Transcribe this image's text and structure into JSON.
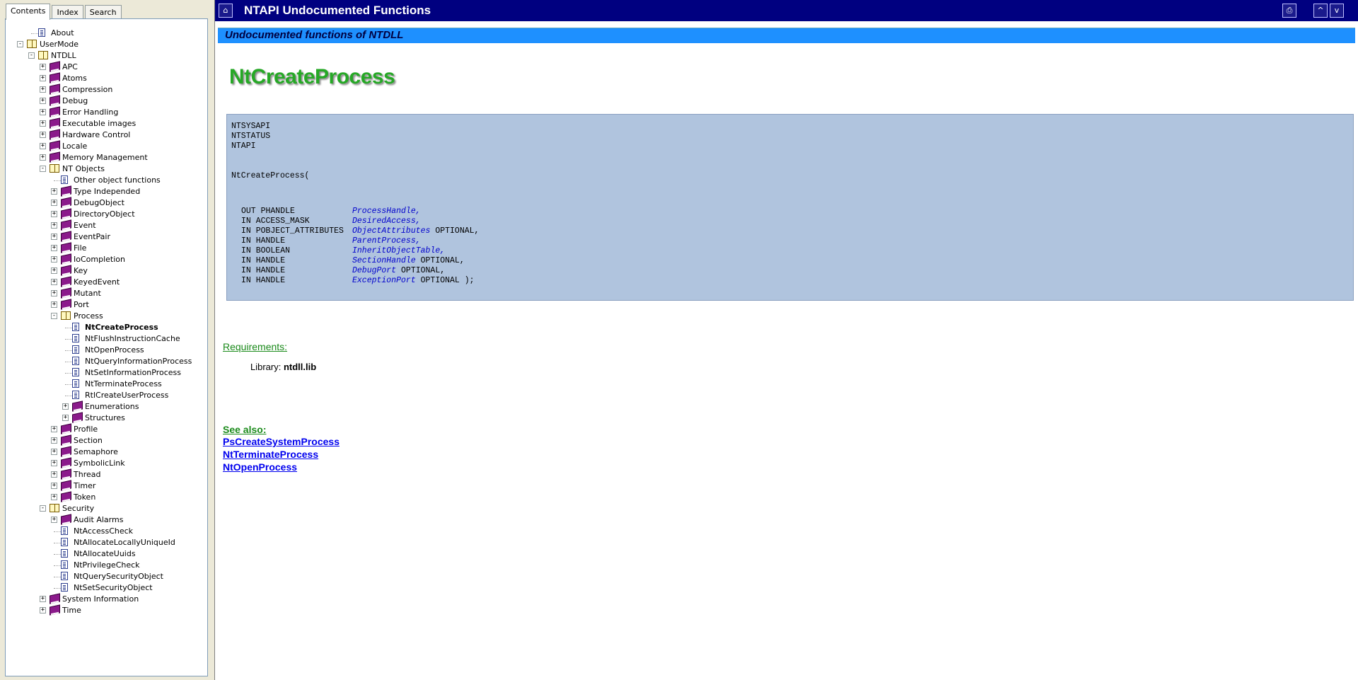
{
  "nav": {
    "tabs": [
      "Contents",
      "Index",
      "Search"
    ],
    "tree": [
      {
        "label": "About",
        "level": 1,
        "icon": "page-icon",
        "exp": "",
        "sel": false
      },
      {
        "label": "UserMode",
        "level": 0,
        "icon": "open-book-icon",
        "exp": "-",
        "sel": false
      },
      {
        "label": "NTDLL",
        "level": 1,
        "icon": "open-book-icon",
        "exp": "-",
        "sel": false
      },
      {
        "label": "APC",
        "level": 2,
        "icon": "book-icon",
        "exp": "+",
        "sel": false
      },
      {
        "label": "Atoms",
        "level": 2,
        "icon": "book-icon",
        "exp": "+",
        "sel": false
      },
      {
        "label": "Compression",
        "level": 2,
        "icon": "book-icon",
        "exp": "+",
        "sel": false
      },
      {
        "label": "Debug",
        "level": 2,
        "icon": "book-icon",
        "exp": "+",
        "sel": false
      },
      {
        "label": "Error Handling",
        "level": 2,
        "icon": "book-icon",
        "exp": "+",
        "sel": false
      },
      {
        "label": "Executable images",
        "level": 2,
        "icon": "book-icon",
        "exp": "+",
        "sel": false
      },
      {
        "label": "Hardware Control",
        "level": 2,
        "icon": "book-icon",
        "exp": "+",
        "sel": false
      },
      {
        "label": "Locale",
        "level": 2,
        "icon": "book-icon",
        "exp": "+",
        "sel": false
      },
      {
        "label": "Memory Management",
        "level": 2,
        "icon": "book-icon",
        "exp": "+",
        "sel": false
      },
      {
        "label": "NT Objects",
        "level": 2,
        "icon": "open-book-icon",
        "exp": "-",
        "sel": false
      },
      {
        "label": "Other object functions",
        "level": 3,
        "icon": "page-icon",
        "exp": "",
        "sel": false
      },
      {
        "label": "Type Independed",
        "level": 3,
        "icon": "book-icon",
        "exp": "+",
        "sel": false
      },
      {
        "label": "DebugObject",
        "level": 3,
        "icon": "book-icon",
        "exp": "+",
        "sel": false
      },
      {
        "label": "DirectoryObject",
        "level": 3,
        "icon": "book-icon",
        "exp": "+",
        "sel": false
      },
      {
        "label": "Event",
        "level": 3,
        "icon": "book-icon",
        "exp": "+",
        "sel": false
      },
      {
        "label": "EventPair",
        "level": 3,
        "icon": "book-icon",
        "exp": "+",
        "sel": false
      },
      {
        "label": "File",
        "level": 3,
        "icon": "book-icon",
        "exp": "+",
        "sel": false
      },
      {
        "label": "IoCompletion",
        "level": 3,
        "icon": "book-icon",
        "exp": "+",
        "sel": false
      },
      {
        "label": "Key",
        "level": 3,
        "icon": "book-icon",
        "exp": "+",
        "sel": false
      },
      {
        "label": "KeyedEvent",
        "level": 3,
        "icon": "book-icon",
        "exp": "+",
        "sel": false
      },
      {
        "label": "Mutant",
        "level": 3,
        "icon": "book-icon",
        "exp": "+",
        "sel": false
      },
      {
        "label": "Port",
        "level": 3,
        "icon": "book-icon",
        "exp": "+",
        "sel": false
      },
      {
        "label": "Process",
        "level": 3,
        "icon": "open-book-icon",
        "exp": "-",
        "sel": false
      },
      {
        "label": "NtCreateProcess",
        "level": 4,
        "icon": "page-icon",
        "exp": "",
        "sel": true
      },
      {
        "label": "NtFlushInstructionCache",
        "level": 4,
        "icon": "page-icon",
        "exp": "",
        "sel": false
      },
      {
        "label": "NtOpenProcess",
        "level": 4,
        "icon": "page-icon",
        "exp": "",
        "sel": false
      },
      {
        "label": "NtQueryInformationProcess",
        "level": 4,
        "icon": "page-icon",
        "exp": "",
        "sel": false
      },
      {
        "label": "NtSetInformationProcess",
        "level": 4,
        "icon": "page-icon",
        "exp": "",
        "sel": false
      },
      {
        "label": "NtTerminateProcess",
        "level": 4,
        "icon": "page-icon",
        "exp": "",
        "sel": false
      },
      {
        "label": "RtlCreateUserProcess",
        "level": 4,
        "icon": "page-icon",
        "exp": "",
        "sel": false
      },
      {
        "label": "Enumerations",
        "level": 4,
        "icon": "book-icon",
        "exp": "+",
        "sel": false
      },
      {
        "label": "Structures",
        "level": 4,
        "icon": "book-icon",
        "exp": "+",
        "sel": false
      },
      {
        "label": "Profile",
        "level": 3,
        "icon": "book-icon",
        "exp": "+",
        "sel": false
      },
      {
        "label": "Section",
        "level": 3,
        "icon": "book-icon",
        "exp": "+",
        "sel": false
      },
      {
        "label": "Semaphore",
        "level": 3,
        "icon": "book-icon",
        "exp": "+",
        "sel": false
      },
      {
        "label": "SymbolicLink",
        "level": 3,
        "icon": "book-icon",
        "exp": "+",
        "sel": false
      },
      {
        "label": "Thread",
        "level": 3,
        "icon": "book-icon",
        "exp": "+",
        "sel": false
      },
      {
        "label": "Timer",
        "level": 3,
        "icon": "book-icon",
        "exp": "+",
        "sel": false
      },
      {
        "label": "Token",
        "level": 3,
        "icon": "book-icon",
        "exp": "+",
        "sel": false
      },
      {
        "label": "Security",
        "level": 2,
        "icon": "open-book-icon",
        "exp": "-",
        "sel": false
      },
      {
        "label": "Audit Alarms",
        "level": 3,
        "icon": "book-icon",
        "exp": "+",
        "sel": false
      },
      {
        "label": "NtAccessCheck",
        "level": 3,
        "icon": "page-icon",
        "exp": "",
        "sel": false
      },
      {
        "label": "NtAllocateLocallyUniqueId",
        "level": 3,
        "icon": "page-icon",
        "exp": "",
        "sel": false
      },
      {
        "label": "NtAllocateUuids",
        "level": 3,
        "icon": "page-icon",
        "exp": "",
        "sel": false
      },
      {
        "label": "NtPrivilegeCheck",
        "level": 3,
        "icon": "page-icon",
        "exp": "",
        "sel": false
      },
      {
        "label": "NtQuerySecurityObject",
        "level": 3,
        "icon": "page-icon",
        "exp": "",
        "sel": false
      },
      {
        "label": "NtSetSecurityObject",
        "level": 3,
        "icon": "page-icon",
        "exp": "",
        "sel": false
      },
      {
        "label": "System Information",
        "level": 2,
        "icon": "book-icon",
        "exp": "+",
        "sel": false
      },
      {
        "label": "Time",
        "level": 2,
        "icon": "book-icon",
        "exp": "+",
        "sel": false
      }
    ]
  },
  "header": {
    "title": "NTAPI Undocumented Functions",
    "subtitle": "Undocumented functions of NTDLL",
    "btn_up": "^",
    "btn_down": "v"
  },
  "main": {
    "function_name": "NtCreateProcess",
    "code_header": [
      "NTSYSAPI",
      "NTSTATUS",
      "NTAPI"
    ],
    "code_decl": "NtCreateProcess(",
    "params": [
      {
        "type": "OUT PHANDLE",
        "name": "ProcessHandle,",
        "suffix": ""
      },
      {
        "type": "IN ACCESS_MASK",
        "name": "DesiredAccess,",
        "suffix": ""
      },
      {
        "type": "IN POBJECT_ATTRIBUTES",
        "name": "ObjectAttributes",
        "suffix": " OPTIONAL,"
      },
      {
        "type": "IN HANDLE",
        "name": "ParentProcess,",
        "suffix": ""
      },
      {
        "type": "IN BOOLEAN",
        "name": "InheritObjectTable,",
        "suffix": ""
      },
      {
        "type": "IN HANDLE",
        "name": "SectionHandle",
        "suffix": " OPTIONAL,"
      },
      {
        "type": "IN HANDLE",
        "name": "DebugPort",
        "suffix": " OPTIONAL,"
      },
      {
        "type": "IN HANDLE",
        "name": "ExceptionPort",
        "suffix": " OPTIONAL );"
      }
    ],
    "requirements_heading": "Requirements:",
    "library_label": "Library: ",
    "library_value": "ntdll.lib",
    "see_also_heading": "See also:",
    "see_also": [
      "PsCreateSystemProcess",
      "NtTerminateProcess",
      "NtOpenProcess"
    ]
  },
  "colors": {
    "title_bar": "#000080",
    "subtitle_bar": "#1e90ff",
    "function_title": "#26a826",
    "code_bg": "#b0c4de",
    "link": "#0000ee"
  }
}
